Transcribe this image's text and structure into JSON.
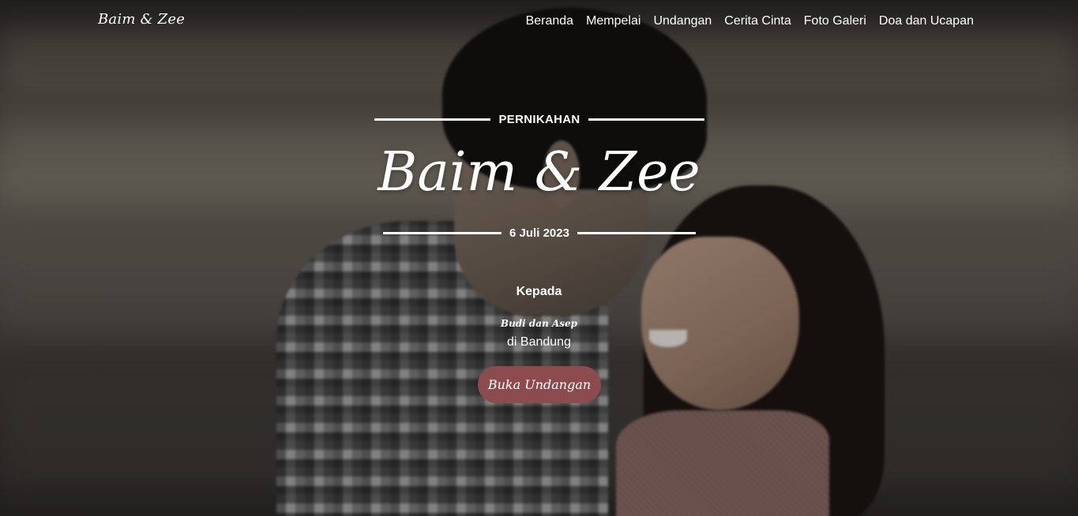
{
  "navbar": {
    "brand": "Baim & Zee",
    "links": [
      {
        "label": "Beranda"
      },
      {
        "label": "Mempelai"
      },
      {
        "label": "Undangan"
      },
      {
        "label": "Cerita Cinta"
      },
      {
        "label": "Foto Galeri"
      },
      {
        "label": "Doa dan Ucapan"
      }
    ]
  },
  "hero": {
    "eyebrow": "PERNIKAHAN",
    "couple": "Baim & Zee",
    "date": "6 Juli 2023",
    "to_label": "Kepada",
    "guest_name": "Budi dan Asep",
    "guest_place": "di Bandung",
    "open_button": "Buka Undangan"
  },
  "colors": {
    "accent": "#8b4b4f",
    "text": "#ffffff"
  }
}
